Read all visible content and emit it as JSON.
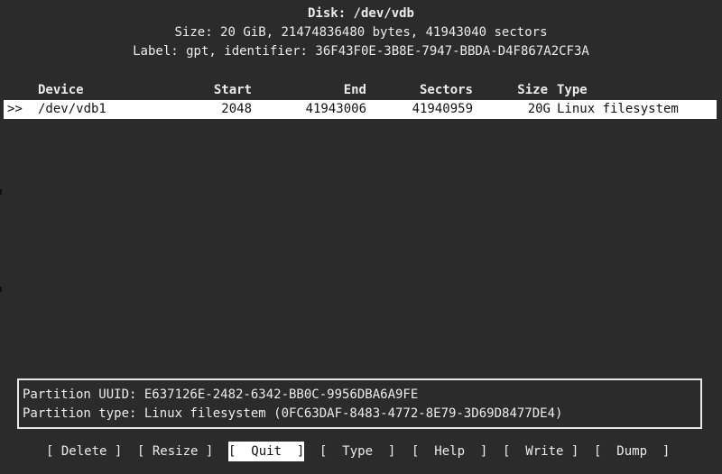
{
  "header": {
    "disk_title": "Disk: /dev/vdb",
    "size_line": "Size: 20 GiB, 21474836480 bytes, 41943040 sectors",
    "label_line": "Label: gpt, identifier: 36F43F0E-3B8E-7947-BBDA-D4F867A2CF3A"
  },
  "table": {
    "columns": {
      "device": "Device",
      "start": "Start",
      "end": "End",
      "sectors": "Sectors",
      "size": "Size",
      "type": "Type"
    },
    "rows": [
      {
        "marker": ">>",
        "device": "/dev/vdb1",
        "start": "2048",
        "end": "41943006",
        "sectors": "41940959",
        "size": "20G",
        "type": "Linux filesystem"
      }
    ]
  },
  "info": {
    "uuid_line": "Partition UUID: E637126E-2482-6342-BB0C-9956DBA6A9FE",
    "type_line": "Partition type: Linux filesystem (0FC63DAF-8483-4772-8E79-3D69D8477DE4)"
  },
  "menu": {
    "selected": "Quit",
    "items": [
      "[ Delete ]",
      "[ Resize ]",
      "[  Quit  ]",
      "[  Type  ]",
      "[  Help  ]",
      "[  Write ]",
      "[  Dump  ]"
    ]
  },
  "colors": {
    "background": "#2b2b2b",
    "foreground": "#ececec",
    "highlight_bg": "#ffffff",
    "highlight_fg": "#111111"
  }
}
